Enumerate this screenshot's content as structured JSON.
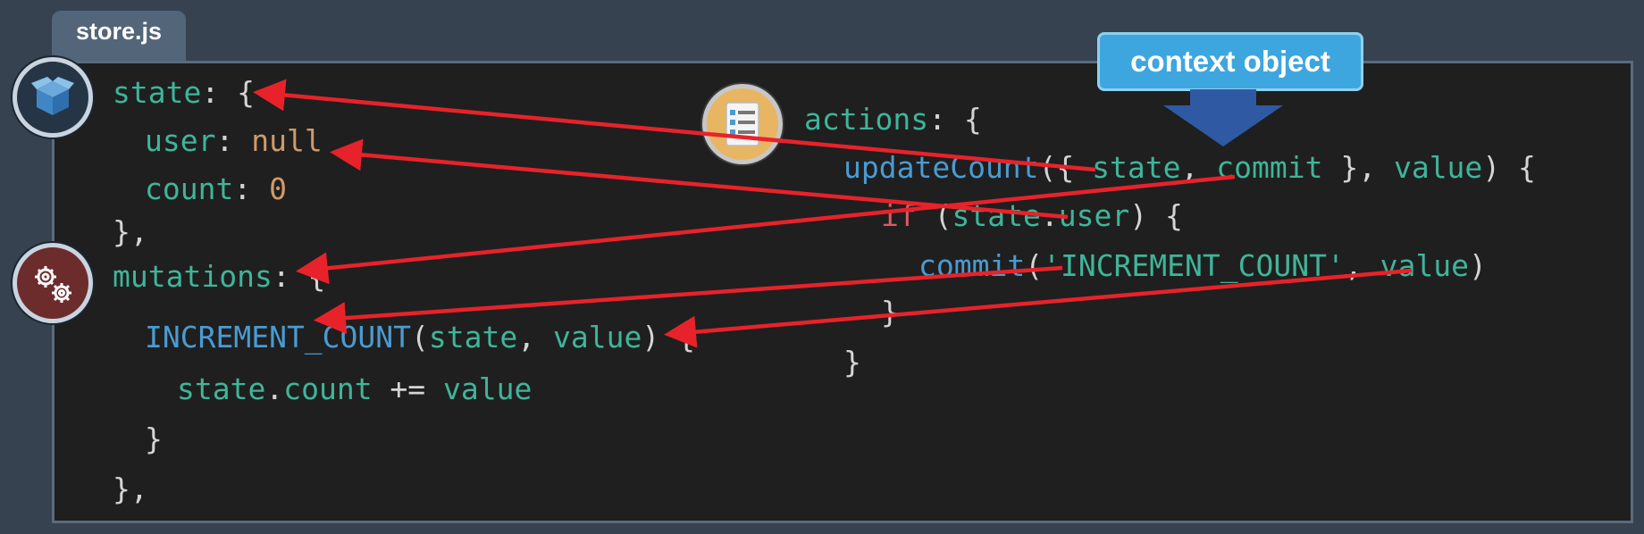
{
  "tab": {
    "label": "store.js"
  },
  "callout": {
    "label": "context object"
  },
  "icons": {
    "state": "box-icon",
    "mutations": "gears-icon",
    "actions": "checklist-icon"
  },
  "colors": {
    "keyword": "#3fb59a",
    "function": "#4a9bd2",
    "value": "#d09a6a",
    "control": "#e05a66",
    "arrow": "#e8222a",
    "callout": "#3ea6df",
    "callout_arrow": "#2f5aa3"
  },
  "left_code": {
    "state_key": "state",
    "state_open": ": {",
    "user_key": "user",
    "user_sep": ": ",
    "user_val": "null",
    "count_key": "count",
    "count_sep": ": ",
    "count_val": "0",
    "state_close": "},",
    "mutations_key": "mutations",
    "mutations_open": ": {",
    "fn_name": "INCREMENT_COUNT",
    "fn_paren_open": "(",
    "fn_arg1": "state",
    "fn_comma": ", ",
    "fn_arg2": "value",
    "fn_paren_close": ") {",
    "body_obj": "state",
    "body_dot": ".",
    "body_prop": "count",
    "body_op": " += ",
    "body_val": "value",
    "fn_close": "}",
    "mutations_close": "},"
  },
  "right_code": {
    "actions_key": "actions",
    "actions_open": ": {",
    "fn_name": "updateCount",
    "fn_open": "({ ",
    "arg_state": "state",
    "arg_comma": ", ",
    "arg_commit": "commit",
    "arg_close": " }, ",
    "arg_value": "value",
    "fn_paren_close": ") {",
    "if_kw": "if",
    "if_open": " (",
    "if_obj": "state",
    "if_dot": ".",
    "if_prop": "user",
    "if_close": ") {",
    "commit_fn": "commit",
    "commit_open": "(",
    "commit_str": "'INCREMENT_COUNT'",
    "commit_comma": ", ",
    "commit_arg": "value",
    "commit_close": ")",
    "if_end": "}",
    "fn_end": "}"
  }
}
